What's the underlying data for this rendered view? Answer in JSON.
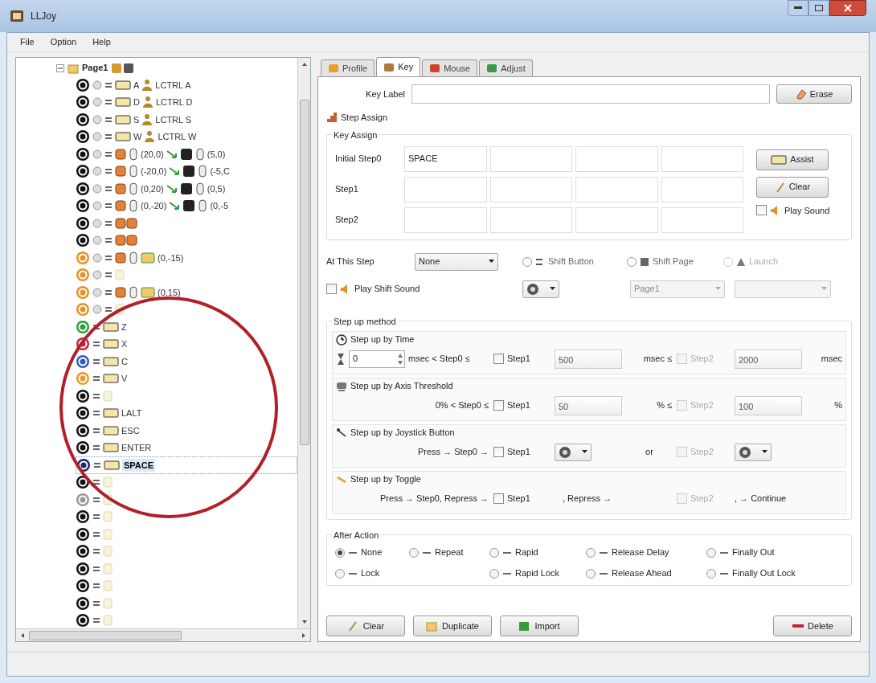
{
  "window": {
    "title": "LLJoy"
  },
  "menu": [
    "File",
    "Option",
    "Help"
  ],
  "annotation": {
    "kind": "ellipse"
  },
  "tree": {
    "label": "Page1",
    "expanded": true,
    "children": [
      {
        "color": "#111111",
        "kind": "key",
        "texts": [
          "A",
          "LCTRL A"
        ],
        "selected": false
      },
      {
        "color": "#111111",
        "kind": "key",
        "texts": [
          "D",
          "LCTRL D"
        ],
        "selected": false
      },
      {
        "color": "#111111",
        "kind": "key",
        "texts": [
          "S",
          "LCTRL S"
        ],
        "selected": false
      },
      {
        "color": "#111111",
        "kind": "key",
        "texts": [
          "W",
          "LCTRL W"
        ],
        "selected": false
      },
      {
        "color": "#111111",
        "kind": "mouse",
        "texts": [
          "(20,0)",
          "(5,0)"
        ],
        "selected": false
      },
      {
        "color": "#111111",
        "kind": "mouse",
        "texts": [
          "(-20,0)",
          "(-5,C"
        ],
        "selected": false
      },
      {
        "color": "#111111",
        "kind": "mouse",
        "texts": [
          "(0,20)",
          "(0,5)"
        ],
        "selected": false
      },
      {
        "color": "#111111",
        "kind": "mouse",
        "texts": [
          "(0,-20)",
          "(0,-5"
        ],
        "selected": false
      },
      {
        "color": "#111111",
        "kind": "pad",
        "selected": false
      },
      {
        "color": "#111111",
        "kind": "pad",
        "selected": false
      },
      {
        "color": "#e8902a",
        "kind": "wheel",
        "texts": [
          "(0,-15)"
        ],
        "selected": false
      },
      {
        "color": "#e8902a",
        "kind": "empty",
        "selected": false
      },
      {
        "color": "#e8902a",
        "kind": "wheel",
        "texts": [
          "(0,15)"
        ],
        "selected": false
      },
      {
        "color": "#e8902a",
        "kind": "empty",
        "selected": false
      },
      {
        "color": "#2e9e3a",
        "kind": "key",
        "texts": [
          "Z"
        ],
        "selected": false
      },
      {
        "color": "#c4243a",
        "kind": "key",
        "texts": [
          "X"
        ],
        "selected": false
      },
      {
        "color": "#2f5fb8",
        "kind": "key",
        "texts": [
          "C"
        ],
        "selected": false
      },
      {
        "color": "#e89a2a",
        "kind": "key",
        "texts": [
          "V"
        ],
        "selected": false
      },
      {
        "color": "#111111",
        "kind": "empty",
        "selected": false
      },
      {
        "color": "#111111",
        "kind": "key",
        "texts": [
          "LALT"
        ],
        "selected": false
      },
      {
        "color": "#111111",
        "kind": "key",
        "texts": [
          "ESC"
        ],
        "selected": false
      },
      {
        "color": "#111111",
        "kind": "key",
        "texts": [
          "ENTER"
        ],
        "selected": false
      },
      {
        "color": "#1c2a6a",
        "kind": "key",
        "texts": [
          "SPACE"
        ],
        "selected": true
      },
      {
        "color": "#111111",
        "kind": "empty",
        "selected": false
      },
      {
        "color": "#999999",
        "kind": "empty",
        "selected": false
      },
      {
        "color": "#111111",
        "kind": "empty",
        "selected": false
      },
      {
        "color": "#111111",
        "kind": "empty",
        "selected": false
      },
      {
        "color": "#111111",
        "kind": "empty",
        "selected": false
      },
      {
        "color": "#111111",
        "kind": "empty",
        "selected": false
      },
      {
        "color": "#111111",
        "kind": "empty",
        "selected": false
      },
      {
        "color": "#111111",
        "kind": "empty",
        "selected": false
      },
      {
        "color": "#111111",
        "kind": "empty",
        "selected": false
      }
    ]
  },
  "tabs": [
    {
      "label": "Profile",
      "selected": false
    },
    {
      "label": "Key",
      "selected": true
    },
    {
      "label": "Mouse",
      "selected": false
    },
    {
      "label": "Adjust",
      "selected": false
    }
  ],
  "key_label": {
    "label": "Key Label",
    "button": "Erase"
  },
  "step_assign": "Step Assign",
  "key_assign": {
    "title": "Key Assign",
    "rows": [
      {
        "label": "Initial Step0",
        "values": [
          "SPACE"
        ]
      },
      {
        "label": "Step1",
        "values": []
      },
      {
        "label": "Step2",
        "values": []
      }
    ],
    "assist_button": "Assist",
    "clear_button": "Clear",
    "play_sound": {
      "label": "Play Sound",
      "checked": false
    }
  },
  "at_this_step": {
    "label": "At This Step",
    "value": "None",
    "options": [
      {
        "label": "Shift Button",
        "selected": false,
        "disabled": false
      },
      {
        "label": "Shift Page",
        "selected": false,
        "disabled": false
      },
      {
        "label": "Launch",
        "selected": false,
        "disabled": true
      }
    ],
    "play_shift_sound": {
      "label": "Play Shift Sound",
      "checked": false
    },
    "page_dropdown": {
      "value": "Page1",
      "disabled": true
    }
  },
  "step_up_method": {
    "title": "Step up method",
    "sections": [
      {
        "kind": "time",
        "title": "Step up by Time",
        "spinner": "0",
        "lead": "msec < Step0 ≤",
        "step1": {
          "label": "Step1",
          "checked": false,
          "disabled": false
        },
        "value1": "500",
        "join": "msec ≤",
        "step2": {
          "label": "Step2",
          "checked": false,
          "disabled": true
        },
        "value2": "2000",
        "tail": "msec"
      },
      {
        "kind": "axis",
        "title": "Step up by Axis Threshold",
        "lead": "0% < Step0 ≤",
        "step1": {
          "label": "Step1",
          "checked": false,
          "disabled": false
        },
        "value1": "50",
        "join": "% ≤",
        "step2": {
          "label": "Step2",
          "checked": false,
          "disabled": true
        },
        "value2": "100",
        "tail": "%"
      },
      {
        "kind": "joystick",
        "title": "Step up by Joystick Button",
        "lead": "Press → Step0 →",
        "step1": {
          "label": "Step1",
          "checked": false,
          "disabled": false
        },
        "join": "or",
        "step2": {
          "label": "Step2",
          "checked": false,
          "disabled": true
        }
      },
      {
        "kind": "toggle",
        "title": "Step up by Toggle",
        "lead": "Press → Step0, Repress →",
        "step1": {
          "label": "Step1",
          "checked": false,
          "disabled": false
        },
        "join": ", Repress →",
        "step2": {
          "label": "Step2",
          "checked": false,
          "disabled": true
        },
        "tail": ", → Continue"
      }
    ]
  },
  "after_action": {
    "title": "After Action",
    "rows": [
      [
        {
          "label": "None",
          "selected": true
        },
        {
          "label": "Repeat",
          "selected": false
        },
        {
          "label": "Rapid",
          "selected": false
        },
        {
          "label": "Release Delay",
          "selected": false
        },
        {
          "label": "Finally Out",
          "selected": false
        }
      ],
      [
        {
          "label": "Lock",
          "selected": false
        },
        "",
        {
          "label": "Rapid Lock",
          "selected": false
        },
        {
          "label": "Release Ahead",
          "selected": false
        },
        {
          "label": "Finally Out Lock",
          "selected": false
        }
      ]
    ]
  },
  "buttons": [
    {
      "kind": "clear",
      "label": "Clear"
    },
    {
      "kind": "duplicate",
      "label": "Duplicate"
    },
    {
      "kind": "import",
      "label": "Import"
    },
    {
      "kind": "delete",
      "label": "Delete"
    }
  ]
}
